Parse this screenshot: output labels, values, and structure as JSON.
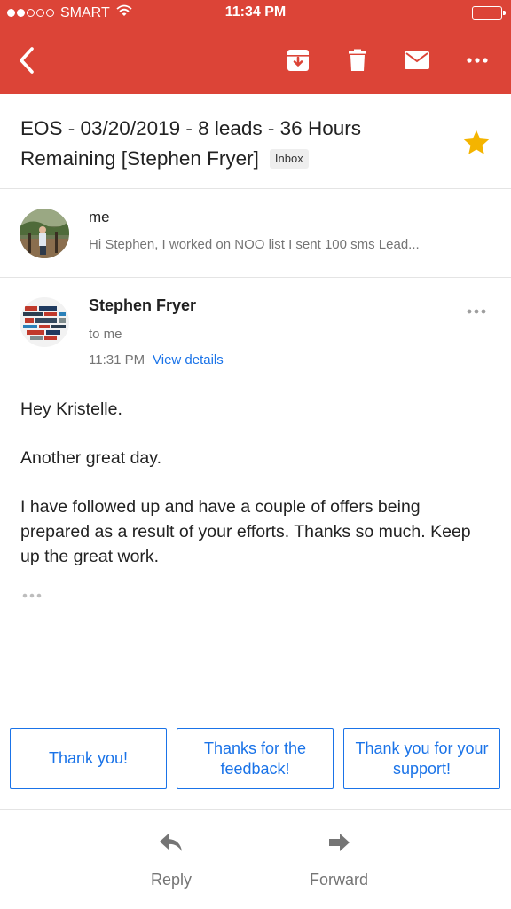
{
  "status_bar": {
    "carrier": "SMART",
    "time": "11:34 PM",
    "signal_bars": 2
  },
  "toolbar": {
    "back_icon": "back-chevron-icon",
    "archive_icon": "archive-icon",
    "delete_icon": "trash-icon",
    "mark_unread_icon": "envelope-icon",
    "more_icon": "more-horizontal-icon",
    "color": "#dc4437"
  },
  "thread": {
    "subject_line1": "EOS - 03/20/2019 - 8 leads - 36 Hours",
    "subject_line2": "Remaining [Stephen Fryer]",
    "label": "Inbox",
    "starred": true,
    "star_color": "#f4b400"
  },
  "collapsed_message": {
    "sender": "me",
    "snippet": "Hi Stephen, I worked on NOO list I sent 100 sms Lead..."
  },
  "expanded_message": {
    "sender": "Stephen Fryer",
    "recipient": "to me",
    "time": "11:31 PM",
    "view_details": "View details",
    "body": [
      "Hey Kristelle.",
      "Another great day.",
      "I have followed up and have a couple of offers being prepared as a result of your efforts. Thanks so much. Keep up the great work."
    ]
  },
  "smart_replies": [
    "Thank you!",
    "Thanks for the feedback!",
    "Thank you for your support!"
  ],
  "bottom_actions": {
    "reply": "Reply",
    "forward": "Forward"
  },
  "colors": {
    "accent": "#1a73e8",
    "header": "#dc4437"
  }
}
